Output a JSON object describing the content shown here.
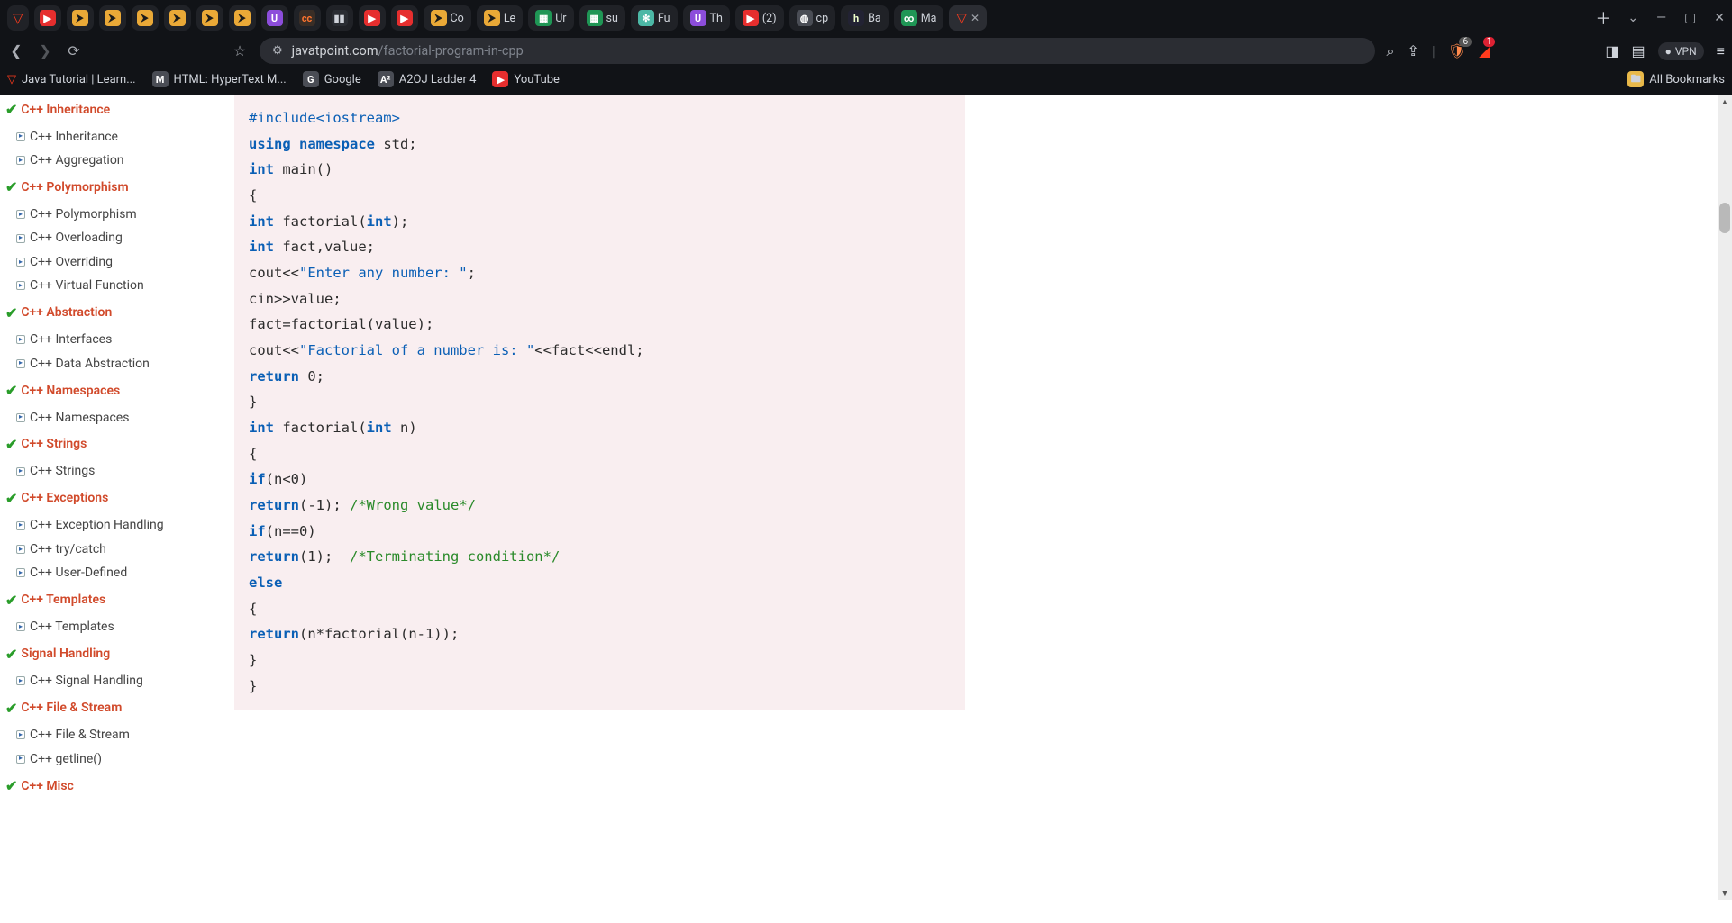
{
  "browser": {
    "tabs": [
      {
        "kind": "icon",
        "slug": "brave",
        "cls": "brave-tri",
        "glyph": "▽"
      },
      {
        "kind": "icon",
        "slug": "yt1",
        "cls": "ico-red",
        "glyph": "▶"
      },
      {
        "kind": "icon",
        "slug": "yel1",
        "cls": "ico-yel",
        "glyph": "⮞"
      },
      {
        "kind": "icon",
        "slug": "yel2",
        "cls": "ico-yel",
        "glyph": "⮞"
      },
      {
        "kind": "icon",
        "slug": "yel3",
        "cls": "ico-yel",
        "glyph": "⮞"
      },
      {
        "kind": "icon",
        "slug": "yel4",
        "cls": "ico-yel",
        "glyph": "⮞"
      },
      {
        "kind": "icon",
        "slug": "yel5",
        "cls": "ico-yel",
        "glyph": "⮞"
      },
      {
        "kind": "icon",
        "slug": "yel6",
        "cls": "ico-yel",
        "glyph": "⮞"
      },
      {
        "kind": "icon",
        "slug": "pur1",
        "cls": "ico-pur",
        "glyph": "U"
      },
      {
        "kind": "icon",
        "slug": "cc",
        "cls": "ico-brown",
        "glyph": "cc"
      },
      {
        "kind": "icon",
        "slug": "bars",
        "cls": "ico-bars",
        "glyph": "▮▮"
      },
      {
        "kind": "icon",
        "slug": "yt2",
        "cls": "ico-red",
        "glyph": "▶"
      },
      {
        "kind": "icon",
        "slug": "yt3",
        "cls": "ico-red",
        "glyph": "▶"
      },
      {
        "kind": "icon+text",
        "slug": "co",
        "cls": "ico-yel",
        "glyph": "⮞",
        "text": "Co"
      },
      {
        "kind": "icon+text",
        "slug": "le",
        "cls": "ico-yel",
        "glyph": "⮞",
        "text": "Le"
      },
      {
        "kind": "icon+text",
        "slug": "ur",
        "cls": "ico-grn",
        "glyph": "▦",
        "text": "Ur"
      },
      {
        "kind": "icon+text",
        "slug": "su",
        "cls": "ico-grn",
        "glyph": "▦",
        "text": "su"
      },
      {
        "kind": "icon+text",
        "slug": "fu",
        "cls": "ico-teal",
        "glyph": "✻",
        "text": "Fu"
      },
      {
        "kind": "icon+text",
        "slug": "th",
        "cls": "ico-pur",
        "glyph": "U",
        "text": "Th"
      },
      {
        "kind": "icon+text",
        "slug": "ytcount",
        "cls": "ico-red",
        "glyph": "▶",
        "text": "(2)"
      },
      {
        "kind": "icon+text",
        "slug": "cp",
        "cls": "ico-grey",
        "glyph": "◍",
        "text": "cp"
      },
      {
        "kind": "icon+text",
        "slug": "ba",
        "cls": "ico-dk",
        "glyph": "h",
        "text": "Ba"
      },
      {
        "kind": "icon+text",
        "slug": "ma",
        "cls": "ico-grn",
        "glyph": "∞",
        "text": "Ma"
      },
      {
        "kind": "active",
        "slug": "current",
        "cls": "brave-tri",
        "glyph": "▽"
      }
    ],
    "url_host": "javatpoint.com",
    "url_path": "/factorial-program-in-cpp",
    "search_icon": "⌕",
    "share_icon": "⇪",
    "shield_badge": "6",
    "warn_badge": "1",
    "vpn_label": "VPN",
    "bookmarks": [
      {
        "slug": "java",
        "iconCls": "brave-tri",
        "glyph": "▽",
        "label": "Java Tutorial | Learn..."
      },
      {
        "slug": "html",
        "iconCls": "ico-grey",
        "glyph": "M",
        "label": "HTML: HyperText M..."
      },
      {
        "slug": "google",
        "iconCls": "ico-grey",
        "glyph": "G",
        "label": "Google"
      },
      {
        "slug": "a2oj",
        "iconCls": "ico-grey",
        "glyph": "A²",
        "label": "A2OJ Ladder 4"
      },
      {
        "slug": "youtube",
        "iconCls": "ico-red",
        "glyph": "▶",
        "label": "YouTube"
      }
    ],
    "all_bookmarks": "All Bookmarks"
  },
  "sidebar": [
    {
      "heading": "C++ Inheritance",
      "items": [
        "C++ Inheritance",
        "C++ Aggregation"
      ]
    },
    {
      "heading": "C++ Polymorphism",
      "items": [
        "C++ Polymorphism",
        "C++ Overloading",
        "C++ Overriding",
        "C++ Virtual Function"
      ]
    },
    {
      "heading": "C++ Abstraction",
      "items": [
        "C++ Interfaces",
        "C++ Data Abstraction"
      ]
    },
    {
      "heading": "C++ Namespaces",
      "items": [
        "C++ Namespaces"
      ]
    },
    {
      "heading": "C++ Strings",
      "items": [
        "C++ Strings"
      ]
    },
    {
      "heading": "C++ Exceptions",
      "items": [
        "C++ Exception Handling",
        "C++ try/catch",
        "C++ User-Defined"
      ]
    },
    {
      "heading": "C++ Templates",
      "items": [
        "C++ Templates"
      ]
    },
    {
      "heading": "Signal Handling",
      "items": [
        "C++ Signal Handling"
      ]
    },
    {
      "heading": "C++ File & Stream",
      "items": [
        "C++ File & Stream",
        "C++ getline()"
      ]
    },
    {
      "heading": "C++ Misc",
      "items": []
    }
  ],
  "code": [
    [
      {
        "c": "pp",
        "t": "#include<iostream>"
      }
    ],
    [
      {
        "c": "kw",
        "t": "using namespace"
      },
      {
        "t": " std;"
      }
    ],
    [
      {
        "c": "kw",
        "t": "int"
      },
      {
        "t": " main()"
      }
    ],
    [
      {
        "t": "{"
      }
    ],
    [
      {
        "c": "kw",
        "t": "int"
      },
      {
        "t": " factorial("
      },
      {
        "c": "kw",
        "t": "int"
      },
      {
        "t": ");"
      }
    ],
    [
      {
        "c": "kw",
        "t": "int"
      },
      {
        "t": " fact,value;"
      }
    ],
    [
      {
        "t": "cout<<"
      },
      {
        "c": "str",
        "t": "\"Enter any number: \""
      },
      {
        "t": ";"
      }
    ],
    [
      {
        "t": "cin>>value;"
      }
    ],
    [
      {
        "t": "fact=factorial(value);"
      }
    ],
    [
      {
        "t": "cout<<"
      },
      {
        "c": "str",
        "t": "\"Factorial of a number is: \""
      },
      {
        "t": "<<fact<<endl;"
      }
    ],
    [
      {
        "c": "kw",
        "t": "return"
      },
      {
        "t": " 0;"
      }
    ],
    [
      {
        "t": "}"
      }
    ],
    [
      {
        "c": "kw",
        "t": "int"
      },
      {
        "t": " factorial("
      },
      {
        "c": "kw",
        "t": "int"
      },
      {
        "t": " n)"
      }
    ],
    [
      {
        "t": "{"
      }
    ],
    [
      {
        "c": "kw",
        "t": "if"
      },
      {
        "t": "(n<0)"
      }
    ],
    [
      {
        "c": "kw",
        "t": "return"
      },
      {
        "t": "(-1); "
      },
      {
        "c": "cmt",
        "t": "/*Wrong value*/"
      }
    ],
    [
      {
        "c": "kw",
        "t": "if"
      },
      {
        "t": "(n==0)"
      }
    ],
    [
      {
        "c": "kw",
        "t": "return"
      },
      {
        "t": "(1);  "
      },
      {
        "c": "cmt",
        "t": "/*Terminating condition*/"
      }
    ],
    [
      {
        "c": "kw",
        "t": "else"
      }
    ],
    [
      {
        "t": "{"
      }
    ],
    [
      {
        "c": "kw",
        "t": "return"
      },
      {
        "t": "(n*factorial(n-1));"
      }
    ],
    [
      {
        "t": "}"
      }
    ],
    [
      {
        "t": "}"
      }
    ]
  ],
  "scroll": {
    "thumb_top_pct": 12,
    "thumb_height_pct": 4
  }
}
